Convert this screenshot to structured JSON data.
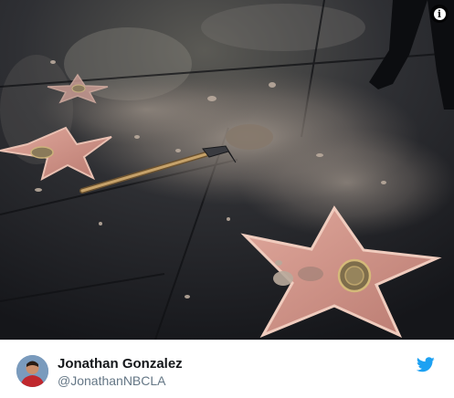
{
  "tweet": {
    "author": {
      "name": "Jonathan Gonzalez",
      "handle": "@JonathanNBCLA"
    },
    "brand_color": "#1da1f2"
  },
  "icons": {
    "info": "info-icon",
    "platform": "twitter-bird-icon"
  }
}
